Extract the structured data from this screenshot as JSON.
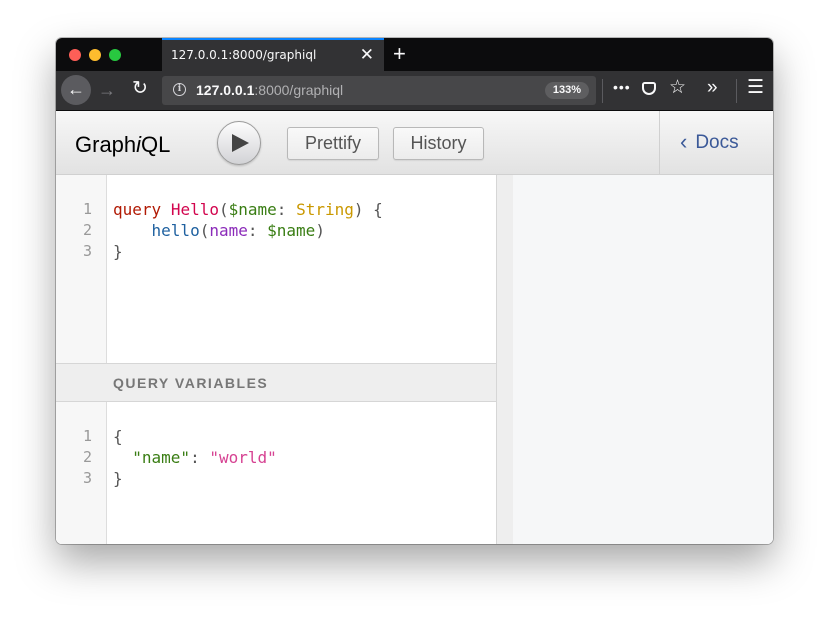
{
  "browser": {
    "tab_title": "127.0.0.1:8000/graphiql",
    "tab_close": "✕",
    "new_tab": "+",
    "url_host": "127.0.0.1",
    "url_rest": ":8000/graphiql",
    "zoom": "133%",
    "icons": [
      "back-arrow-icon",
      "forward-arrow-icon",
      "reload-icon",
      "info-icon",
      "more-icon",
      "pocket-icon",
      "star-icon",
      "overflow-icon",
      "menu-icon"
    ]
  },
  "graphiql": {
    "logo_prefix": "Graph",
    "logo_i": "i",
    "logo_suffix": "QL",
    "prettify_label": "Prettify",
    "history_label": "History",
    "docs_label": "Docs",
    "query_variables_title": "QUERY VARIABLES",
    "query_lines": [
      {
        "n": "1",
        "parts": [
          "query",
          " ",
          "Hello",
          "(",
          "$name",
          ": ",
          "String",
          ") {"
        ]
      },
      {
        "n": "2",
        "parts": [
          "    ",
          "hello",
          "(",
          "name",
          ": ",
          "$name",
          ")"
        ]
      },
      {
        "n": "3",
        "parts": [
          "}"
        ]
      }
    ],
    "variable_lines": [
      {
        "n": "1",
        "parts": [
          "{"
        ]
      },
      {
        "n": "2",
        "parts": [
          "  ",
          "\"name\"",
          ": ",
          "\"world\""
        ]
      },
      {
        "n": "3",
        "parts": [
          "}"
        ]
      }
    ]
  },
  "colors": {
    "keyword": "#b11a04",
    "def": "#d2054e",
    "variable": "#397d13",
    "type": "#ca9800",
    "property": "#1f61a0",
    "attribute": "#8b2bb9",
    "string": "#d64292",
    "docs_link": "#3b5998"
  }
}
